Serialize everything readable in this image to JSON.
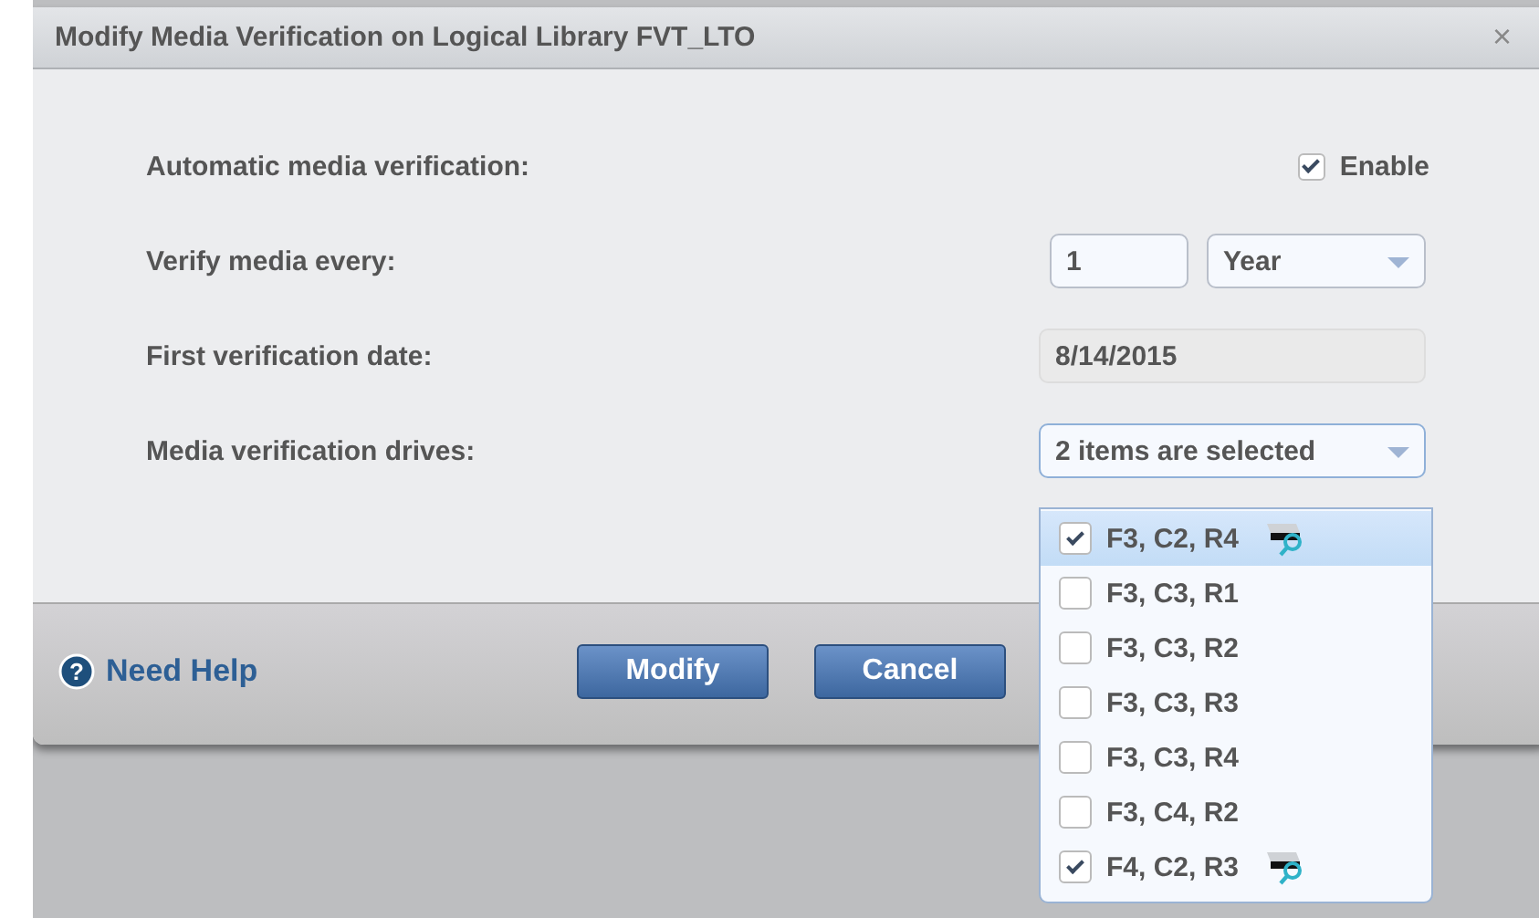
{
  "dialog": {
    "title": "Modify Media Verification on Logical Library FVT_LTO",
    "close": "×"
  },
  "fields": [
    {
      "kind": "checkbox",
      "label": "Automatic media verification:",
      "checked": true,
      "text": "Enable"
    },
    {
      "kind": "interval",
      "label": "Verify media every:",
      "value": "1",
      "unit": "Year"
    },
    {
      "kind": "date",
      "label": "First verification date:",
      "value": "8/14/2015"
    },
    {
      "kind": "multiselect",
      "label": "Media verification drives:",
      "value": "2 items are selected"
    }
  ],
  "drives": [
    {
      "label": "F3, C2, R4",
      "checked": true,
      "selected": true,
      "drive_icon": true
    },
    {
      "label": "F3, C3, R1",
      "checked": false,
      "selected": false,
      "drive_icon": false
    },
    {
      "label": "F3, C3, R2",
      "checked": false,
      "selected": false,
      "drive_icon": false
    },
    {
      "label": "F3, C3, R3",
      "checked": false,
      "selected": false,
      "drive_icon": false
    },
    {
      "label": "F3, C3, R4",
      "checked": false,
      "selected": false,
      "drive_icon": false
    },
    {
      "label": "F3, C4, R2",
      "checked": false,
      "selected": false,
      "drive_icon": false
    },
    {
      "label": "F4, C2, R3",
      "checked": true,
      "selected": false,
      "drive_icon": true
    }
  ],
  "footer": {
    "help_icon": "?",
    "help": "Need Help",
    "buttons": [
      "Modify",
      "Cancel"
    ]
  }
}
